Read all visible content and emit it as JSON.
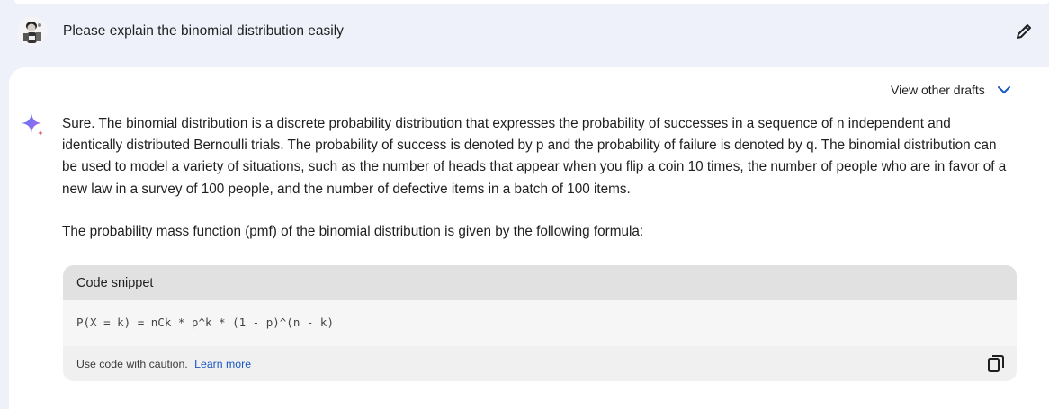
{
  "prompt": {
    "text": "Please explain the binomial distribution easily",
    "avatar_icon": "user-avatar",
    "edit_icon": "pencil-icon"
  },
  "response": {
    "view_drafts_label": "View other drafts",
    "paragraph1": "Sure. The binomial distribution is a discrete probability distribution that expresses the probability of successes in a sequence of n independent and identically distributed Bernoulli trials. The probability of success is denoted by p and the probability of failure is denoted by q. The binomial distribution can be used to model a variety of situations, such as the number of heads that appear when you flip a coin 10 times, the number of people who are in favor of a new law in a survey of 100 people, and the number of defective items in a batch of 100 items.",
    "paragraph2": "The probability mass function (pmf) of the binomial distribution is given by the following formula:",
    "code": {
      "header": "Code snippet",
      "content": "P(X = k) = nCk * p^k * (1 - p)^(n - k)",
      "caution": "Use code with caution.",
      "learn_more": "Learn more"
    }
  },
  "colors": {
    "background": "#eef1fa",
    "card": "#ffffff",
    "link": "#1a56c4",
    "chevron": "#1a56c4",
    "spark_blue": "#4f7df3",
    "spark_pink": "#e0566f"
  }
}
